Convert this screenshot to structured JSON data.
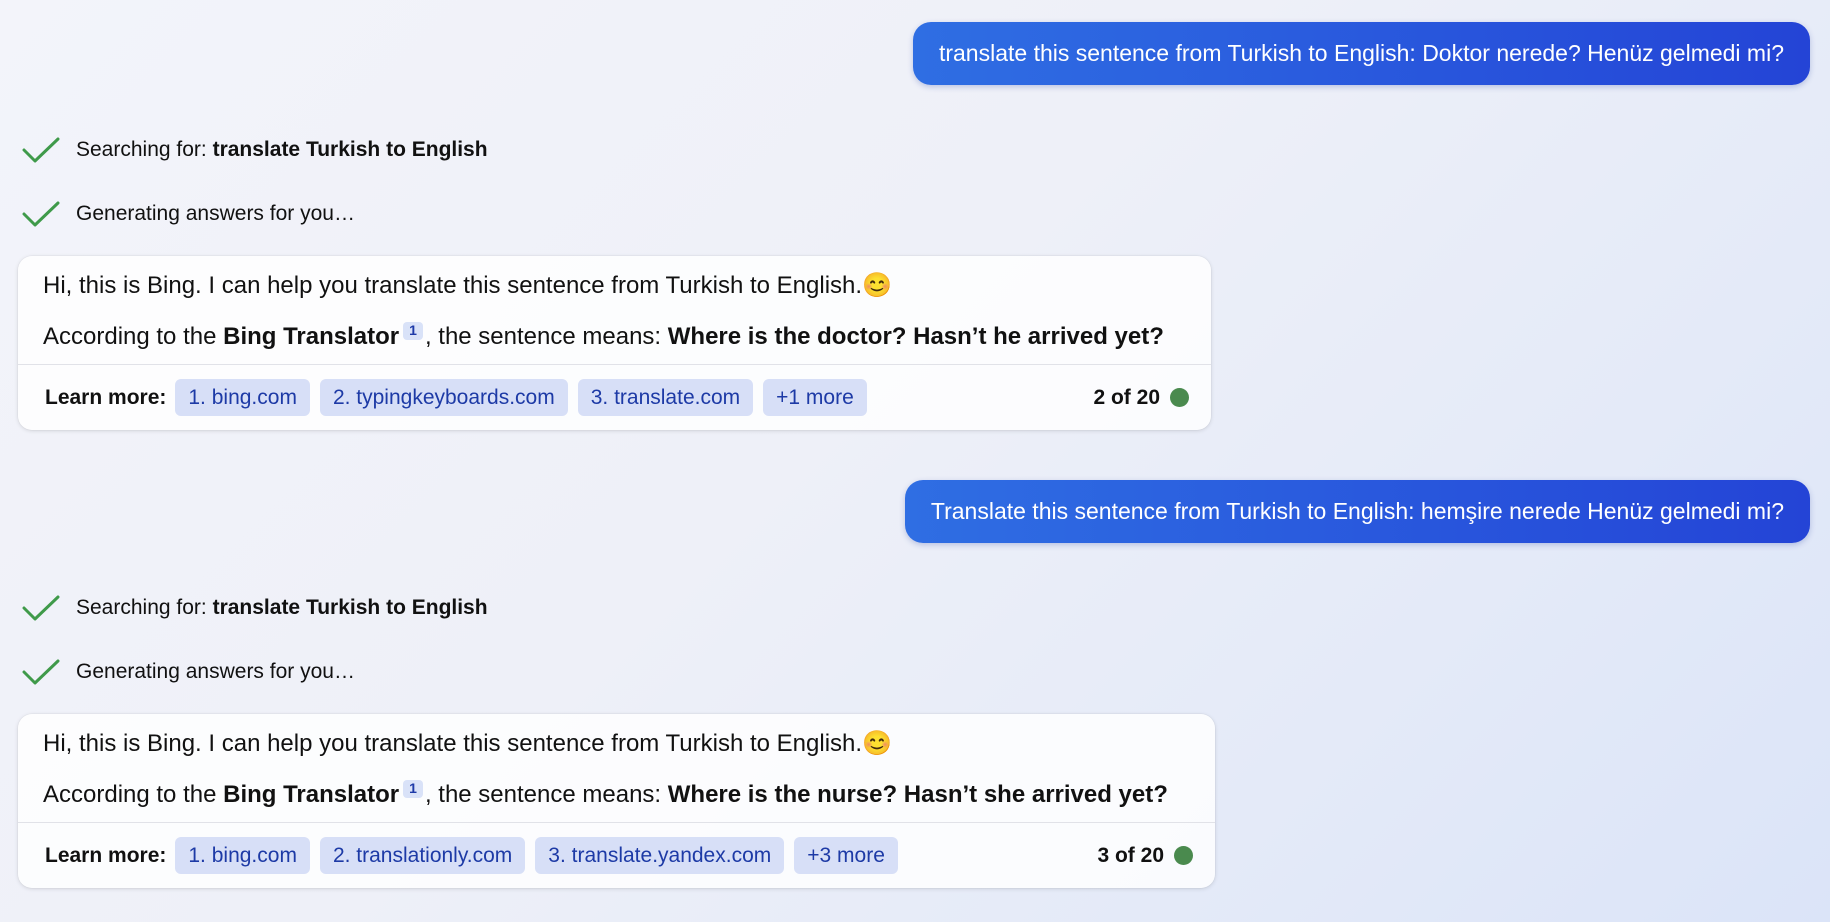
{
  "conversation": [
    {
      "user_message": "translate this sentence from Turkish to English: Doktor nerede? Henüz gelmedi mi?",
      "status_search_prefix": "Searching for: ",
      "status_search_query": "translate Turkish to English",
      "status_generating": "Generating answers for you…",
      "reply_line1": "Hi, this is Bing. I can help you translate this sentence from Turkish to English.",
      "reply_emoji": "😊",
      "reply_line2_prefix": "According to the ",
      "reply_source_name": "Bing Translator",
      "reply_citation": "1",
      "reply_line2_middle": ", the sentence means: ",
      "reply_translation": "Where is the doctor? Hasn’t he arrived yet?",
      "learn_more_label": "Learn more:",
      "links": [
        "1. bing.com",
        "2. typingkeyboards.com",
        "3. translate.com",
        "+1 more"
      ],
      "counter": "2 of 20"
    },
    {
      "user_message": "Translate this sentence from Turkish to English: hemşire nerede Henüz gelmedi mi?",
      "status_search_prefix": "Searching for: ",
      "status_search_query": "translate Turkish to English",
      "status_generating": "Generating answers for you…",
      "reply_line1": "Hi, this is Bing. I can help you translate this sentence from Turkish to English.",
      "reply_emoji": "😊",
      "reply_line2_prefix": "According to the ",
      "reply_source_name": "Bing Translator",
      "reply_citation": "1",
      "reply_line2_middle": ", the sentence means: ",
      "reply_translation": "Where is the nurse? Hasn’t she arrived yet?",
      "learn_more_label": "Learn more:",
      "links": [
        "1. bing.com",
        "2. translationly.com",
        "3. translate.yandex.com",
        "+3 more"
      ],
      "counter": "3 of 20"
    }
  ],
  "colors": {
    "user_bubble": "#2855dc",
    "check": "#3f9a4a",
    "chip_bg": "#d7dff7",
    "chip_text": "#1d3aa6",
    "status_dot": "#4a8a4e"
  },
  "icons": {
    "status": "check-icon",
    "turn_indicator": "status-dot-icon"
  }
}
